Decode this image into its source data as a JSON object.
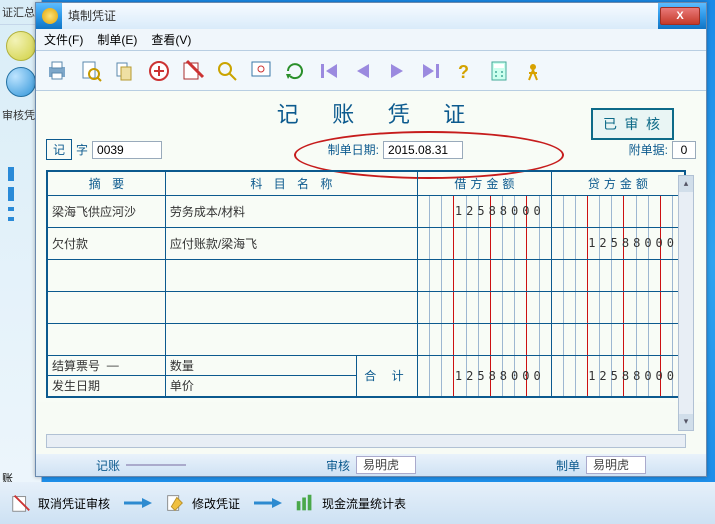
{
  "window": {
    "title": "填制凭证",
    "close_label": "X"
  },
  "menubar": {
    "file": "文件(F)",
    "entry": "制单(E)",
    "view": "查看(V)"
  },
  "sidebar": {
    "stub_top": "证汇总",
    "stub_mid": "审核凭",
    "stub_acct": "账"
  },
  "doc": {
    "title": "记 账 凭 证",
    "stamp": "已 审 核",
    "ji": "记",
    "zi": "字",
    "seq": "0039",
    "date_label": "制单日期:",
    "date_value": "2015.08.31",
    "attach_label": "附单据:",
    "attach_count": "0"
  },
  "headers": {
    "summary": "摘    要",
    "subject": "科  目  名  称",
    "debit": "借方金额",
    "credit": "贷方金额"
  },
  "rows": [
    {
      "summary": "梁海飞供应河沙",
      "subject": "劳务成本/材料",
      "debit": "12588000",
      "credit": ""
    },
    {
      "summary": "欠付款",
      "subject": "应付账款/梁海飞",
      "debit": "",
      "credit": "12588000"
    },
    {
      "summary": "",
      "subject": "",
      "debit": "",
      "credit": ""
    },
    {
      "summary": "",
      "subject": "",
      "debit": "",
      "credit": ""
    },
    {
      "summary": "",
      "subject": "",
      "debit": "",
      "credit": ""
    }
  ],
  "totals": {
    "ticket_no_label": "结算票号",
    "ticket_no": "—",
    "qty_label": "数量",
    "date_label": "发生日期",
    "price_label": "单价",
    "total_label": "合   计",
    "debit_total": "12588000",
    "credit_total": "12588000"
  },
  "status": {
    "post_label": "记账",
    "audit_label": "审核",
    "audit_value": "易明虎",
    "prep_label": "制单",
    "prep_value": "易明虎"
  },
  "footer": {
    "cancel_audit": "取消凭证审核",
    "modify": "修改凭证",
    "cashflow": "现金流量统计表"
  }
}
